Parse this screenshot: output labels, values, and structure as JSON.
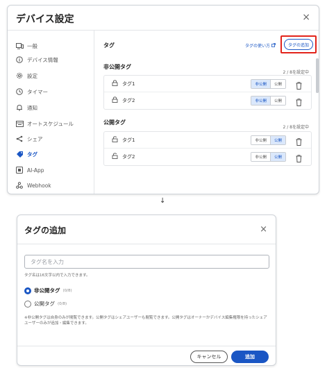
{
  "settings_dialog": {
    "title": "デバイス設定",
    "close_glyph": "×",
    "sidebar": {
      "items": [
        {
          "label": "一般",
          "icon": "device-icon"
        },
        {
          "label": "デバイス情報",
          "icon": "info-icon"
        },
        {
          "label": "設定",
          "icon": "gear-icon"
        },
        {
          "label": "タイマー",
          "icon": "clock-icon"
        },
        {
          "label": "通知",
          "icon": "bell-icon"
        },
        {
          "label": "オートスケジュール",
          "icon": "schedule-icon"
        },
        {
          "label": "シェア",
          "icon": "share-icon"
        },
        {
          "label": "タグ",
          "icon": "tag-icon",
          "active": true
        },
        {
          "label": "AI-App",
          "icon": "ai-app-icon"
        },
        {
          "label": "Webhook",
          "icon": "webhook-icon"
        }
      ]
    },
    "content": {
      "title": "タグ",
      "usage_link": "タグの使い方",
      "add_button": "タグの追加",
      "private_section": {
        "title": "非公開タグ",
        "count": "2 / 8を設定中",
        "rows": [
          {
            "name": "タグ1",
            "selected": "非公開"
          },
          {
            "name": "タグ2",
            "selected": "非公開"
          }
        ]
      },
      "public_section": {
        "title": "公開タグ",
        "count": "2 / 8を設定中",
        "rows": [
          {
            "name": "タグ1",
            "selected": "公開"
          },
          {
            "name": "タグ2",
            "selected": "公開"
          }
        ]
      },
      "toggle": {
        "private": "非公開",
        "public": "公開"
      }
    }
  },
  "arrow": "↓",
  "add_tag_dialog": {
    "title": "タグの追加",
    "close_glyph": "×",
    "input_placeholder": "タグ名を入力",
    "input_hint": "タグ名は16文字以内で入力できます。",
    "options": [
      {
        "label": "非公開タグ",
        "count": "(0/8)",
        "checked": true
      },
      {
        "label": "公開タグ",
        "count": "(0/8)",
        "checked": false
      }
    ],
    "note": "※非公開タグは自身のみが閲覧できます。公開タグはシェアユーザーも閲覧できます。公開タグはオーナーかデバイス編集権限を持ったシェアユーザーのみが追加・編集できます。",
    "cancel_label": "キャンセル",
    "confirm_label": "追加"
  },
  "colors": {
    "accent": "#1a56c4",
    "highlight": "#e2231a"
  }
}
